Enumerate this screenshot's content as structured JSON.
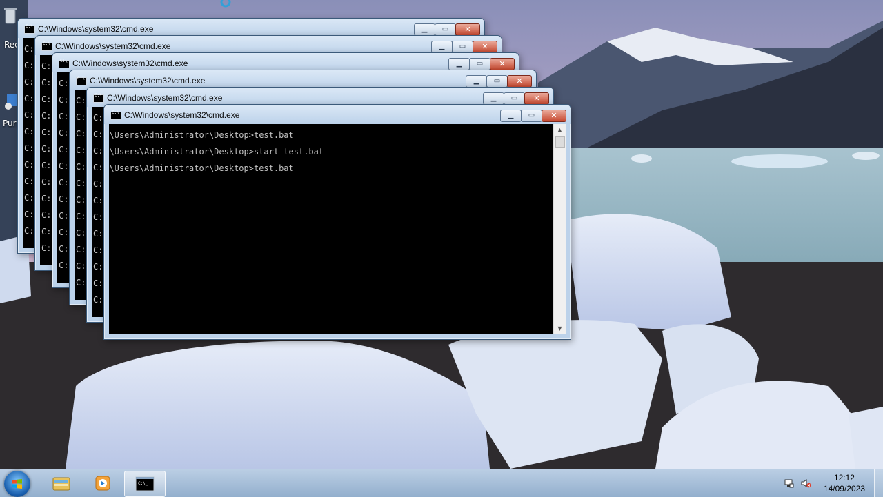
{
  "desktop": {
    "icons": [
      {
        "label": "Rec"
      },
      {
        "label": "Purl"
      }
    ]
  },
  "window_title": "C:\\Windows\\system32\\cmd.exe",
  "windows_visible_prompt_char": "C:",
  "front_window": {
    "title": "C:\\Windows\\system32\\cmd.exe",
    "lines": [
      "C:\\Users\\Administrator\\Desktop>test.bat",
      "C:\\Users\\Administrator\\Desktop>start test.bat",
      "C:\\Users\\Administrator\\Desktop>test.bat"
    ]
  },
  "controls": {
    "minimize_glyph": "▁",
    "maximize_glyph": "▭",
    "close_glyph": "✕"
  },
  "taskbar": {
    "items": [
      {
        "name": "Windows Explorer",
        "icon": "folder-icon"
      },
      {
        "name": "Windows Media Player",
        "icon": "media-player-icon"
      },
      {
        "name": "cmd.exe",
        "icon": "cmd-icon",
        "active": true
      }
    ],
    "clock_time": "12:12",
    "clock_date": "14/09/2023"
  },
  "colors": {
    "console_bg": "#000000",
    "console_text": "#c0c0c0",
    "close_button": "#c7482f"
  }
}
